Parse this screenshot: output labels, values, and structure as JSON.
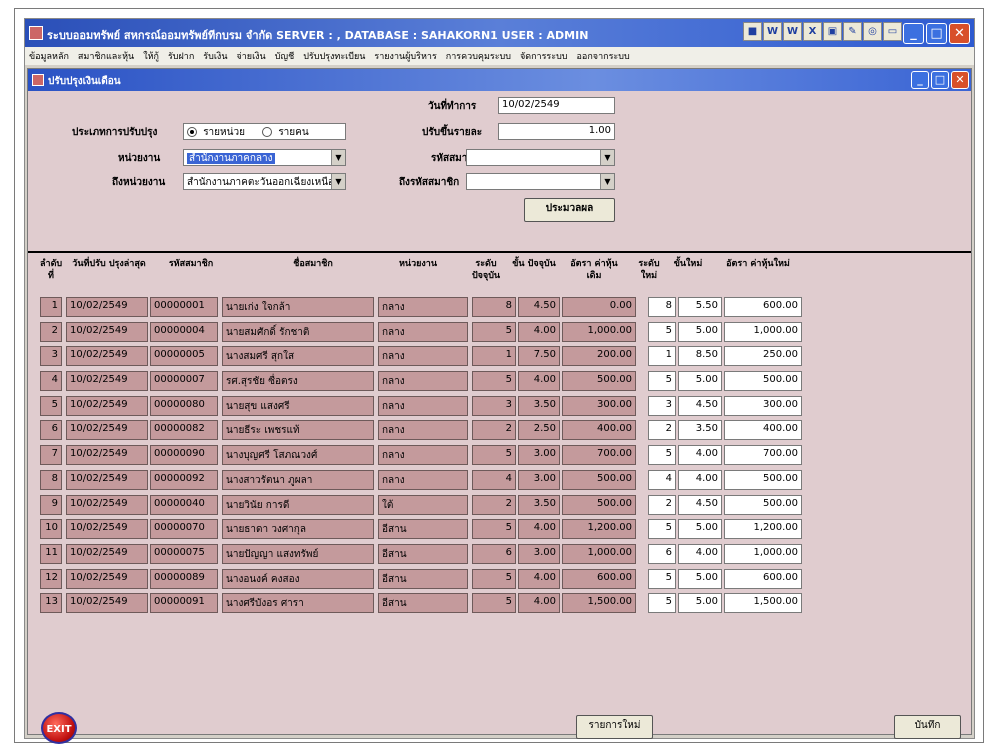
{
  "window": {
    "title": "ระบบออมทรัพย์ สหกรณ์ออมทรัพย์ทีกบรม จำกัด SERVER : , DATABASE : SAHAKORN1 USER : ADMIN",
    "toolbar_icons": [
      "app-icon",
      "word-icon",
      "word-doc-icon",
      "excel-icon",
      "chart-icon",
      "paint-icon",
      "cd-icon",
      "folder-icon"
    ]
  },
  "menu": [
    "ข้อมูลหลัก",
    "สมาชิกและหุ้น",
    "ให้กู้",
    "รับฝาก",
    "รับเงิน",
    "จ่ายเงิน",
    "บัญชี",
    "ปรับปรุงทะเบียน",
    "รายงานผู้บริหาร",
    "การควบคุมระบบ",
    "จัดการระบบ",
    "ออกจากระบบ"
  ],
  "child": {
    "title": "ปรับปรุงเงินเดือน"
  },
  "form": {
    "date_label": "วันที่ทำการ",
    "date_value": "10/02/2549",
    "type_label": "ประเภทการปรับปรุง",
    "radio1": "รายหน่วย",
    "radio2": "รายคน",
    "rate_label": "ปรับขึ้นรายละ",
    "rate_value": "1.00",
    "unit_label": "หน่วยงาน",
    "unit_value": "สำนักงานภาคกลาง",
    "member_label": "รหัสสมาชิก",
    "member_value": "",
    "to_unit_label": "ถึงหน่วยงาน",
    "to_unit_value": "สำนักงานภาคตะวันออกเฉียงเหนือ",
    "to_member_label": "ถึงรหัสสมาชิก",
    "to_member_value": "",
    "process_button": "ประมวลผล"
  },
  "table": {
    "headers": {
      "no": "ลำดับ ที่",
      "date": "วันที่ปรับ ปรุงล่าสุด",
      "code": "รหัสสมาชิก",
      "name": "ชื่อสมาชิก",
      "unit": "หน่วยงาน",
      "cur_level": "ระดับ ปัจจุบัน",
      "cur_step": "ขั้น ปัจจุบัน",
      "old_rate": "อัตรา ค่าหุ้นเดิม",
      "new_level": "ระดับ ใหม่",
      "new_step": "ขั้นใหม่",
      "new_rate": "อัตรา ค่าหุ้นใหม่"
    },
    "rows": [
      {
        "no": "1",
        "date": "10/02/2549",
        "code": "00000001",
        "name": "นายเก่ง ใจกล้า",
        "unit": "กลาง",
        "cur_level": "8",
        "cur_step": "4.50",
        "old_rate": "0.00",
        "new_level": "8",
        "new_step": "5.50",
        "new_rate": "600.00"
      },
      {
        "no": "2",
        "date": "10/02/2549",
        "code": "00000004",
        "name": "นายสมศักดิ์ รักชาติ",
        "unit": "กลาง",
        "cur_level": "5",
        "cur_step": "4.00",
        "old_rate": "1,000.00",
        "new_level": "5",
        "new_step": "5.00",
        "new_rate": "1,000.00"
      },
      {
        "no": "3",
        "date": "10/02/2549",
        "code": "00000005",
        "name": "นางสมศรี สุกใส",
        "unit": "กลาง",
        "cur_level": "1",
        "cur_step": "7.50",
        "old_rate": "200.00",
        "new_level": "1",
        "new_step": "8.50",
        "new_rate": "250.00"
      },
      {
        "no": "4",
        "date": "10/02/2549",
        "code": "00000007",
        "name": "รศ.สุรชัย ซื่อตรง",
        "unit": "กลาง",
        "cur_level": "5",
        "cur_step": "4.00",
        "old_rate": "500.00",
        "new_level": "5",
        "new_step": "5.00",
        "new_rate": "500.00"
      },
      {
        "no": "5",
        "date": "10/02/2549",
        "code": "00000080",
        "name": "นายสุข แสงศรี",
        "unit": "กลาง",
        "cur_level": "3",
        "cur_step": "3.50",
        "old_rate": "300.00",
        "new_level": "3",
        "new_step": "4.50",
        "new_rate": "300.00"
      },
      {
        "no": "6",
        "date": "10/02/2549",
        "code": "00000082",
        "name": "นายธีระ เพชรแท้",
        "unit": "กลาง",
        "cur_level": "2",
        "cur_step": "2.50",
        "old_rate": "400.00",
        "new_level": "2",
        "new_step": "3.50",
        "new_rate": "400.00"
      },
      {
        "no": "7",
        "date": "10/02/2549",
        "code": "00000090",
        "name": "นางบุญศรี โสภณวงศ์",
        "unit": "กลาง",
        "cur_level": "5",
        "cur_step": "3.00",
        "old_rate": "700.00",
        "new_level": "5",
        "new_step": "4.00",
        "new_rate": "700.00"
      },
      {
        "no": "8",
        "date": "10/02/2549",
        "code": "00000092",
        "name": "นางสาวรัตนา ภูผลา",
        "unit": "กลาง",
        "cur_level": "4",
        "cur_step": "3.00",
        "old_rate": "500.00",
        "new_level": "4",
        "new_step": "4.00",
        "new_rate": "500.00"
      },
      {
        "no": "9",
        "date": "10/02/2549",
        "code": "00000040",
        "name": "นายวินัย การดี",
        "unit": "ใต้",
        "cur_level": "2",
        "cur_step": "3.50",
        "old_rate": "500.00",
        "new_level": "2",
        "new_step": "4.50",
        "new_rate": "500.00"
      },
      {
        "no": "10",
        "date": "10/02/2549",
        "code": "00000070",
        "name": "นายธาดา วงศากุล",
        "unit": "อีสาน",
        "cur_level": "5",
        "cur_step": "4.00",
        "old_rate": "1,200.00",
        "new_level": "5",
        "new_step": "5.00",
        "new_rate": "1,200.00"
      },
      {
        "no": "11",
        "date": "10/02/2549",
        "code": "00000075",
        "name": "นายปัญญา แสงทรัพย์",
        "unit": "อีสาน",
        "cur_level": "6",
        "cur_step": "3.00",
        "old_rate": "1,000.00",
        "new_level": "6",
        "new_step": "4.00",
        "new_rate": "1,000.00"
      },
      {
        "no": "12",
        "date": "10/02/2549",
        "code": "00000089",
        "name": "นางอนงค์ คงสอง",
        "unit": "อีสาน",
        "cur_level": "5",
        "cur_step": "4.00",
        "old_rate": "600.00",
        "new_level": "5",
        "new_step": "5.00",
        "new_rate": "600.00"
      },
      {
        "no": "13",
        "date": "10/02/2549",
        "code": "00000091",
        "name": "นางศรีบังอร ศารา",
        "unit": "อีสาน",
        "cur_level": "5",
        "cur_step": "4.00",
        "old_rate": "1,500.00",
        "new_level": "5",
        "new_step": "5.00",
        "new_rate": "1,500.00"
      }
    ]
  },
  "footer": {
    "exit_label": "EXIT",
    "new_button": "รายการใหม่",
    "save_button": "บันทึก"
  }
}
